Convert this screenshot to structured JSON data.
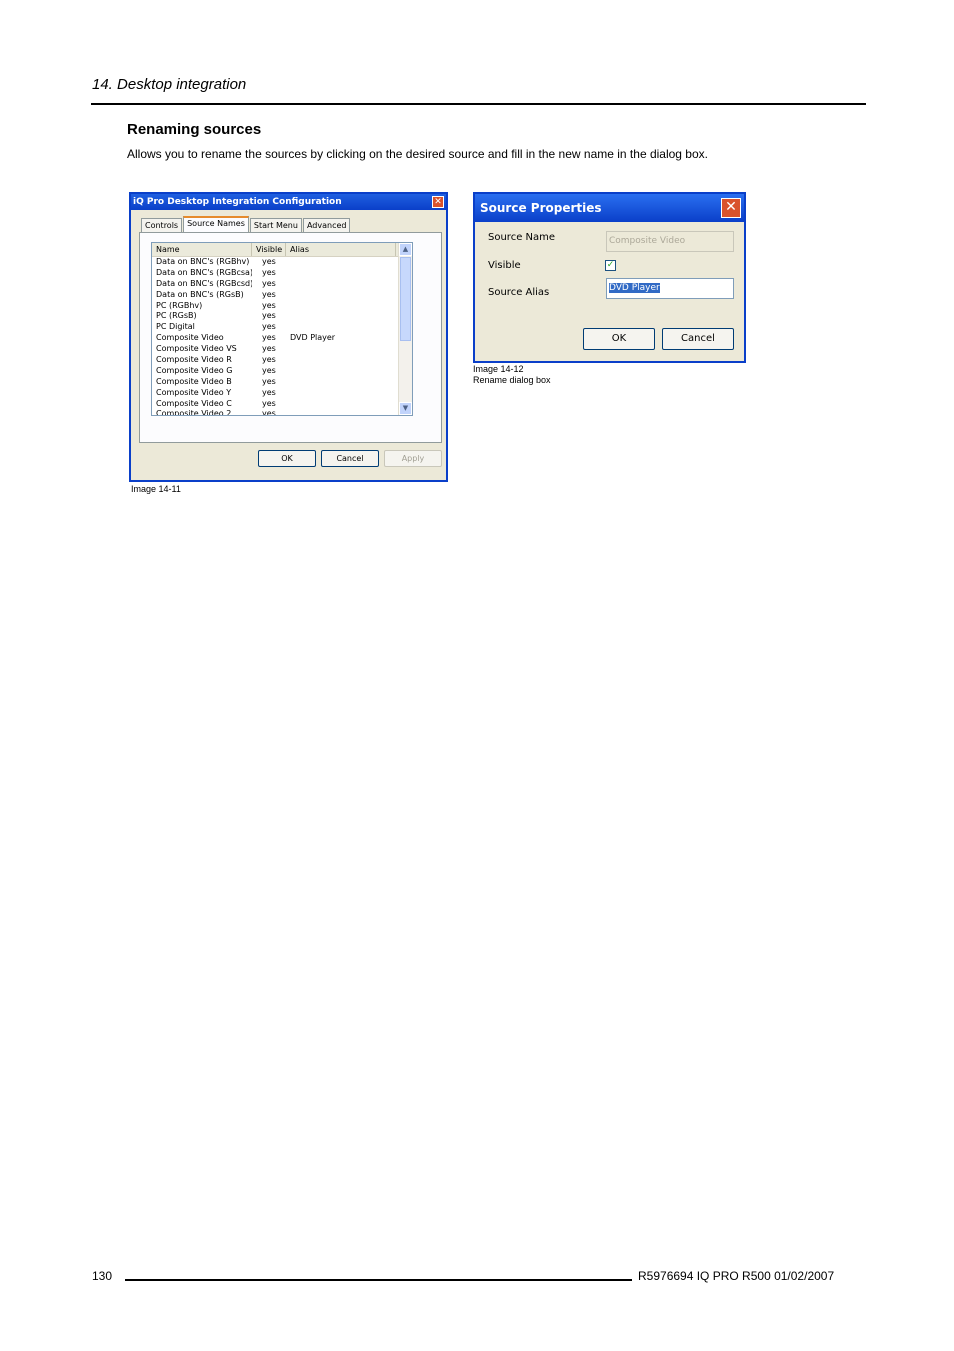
{
  "chapter": "14.  Desktop integration",
  "section_title": "Renaming sources",
  "intro": "Allows you to rename the sources by clicking on the desired source and fill in the new name in the dialog box.",
  "dialog1": {
    "title": "iQ Pro Desktop Integration Configuration",
    "tabs": [
      "Controls",
      "Source Names",
      "Start Menu",
      "Advanced"
    ],
    "columns": [
      "Name",
      "Visible",
      "Alias"
    ],
    "rows": [
      {
        "name": "Data on BNC's (RGBhv)",
        "visible": "yes",
        "alias": ""
      },
      {
        "name": "Data on BNC's (RGBcsa)",
        "visible": "yes",
        "alias": ""
      },
      {
        "name": "Data on BNC's (RGBcsd)",
        "visible": "yes",
        "alias": ""
      },
      {
        "name": "Data on BNC's (RGsB)",
        "visible": "yes",
        "alias": ""
      },
      {
        "name": "PC (RGBhv)",
        "visible": "yes",
        "alias": ""
      },
      {
        "name": "PC (RGsB)",
        "visible": "yes",
        "alias": ""
      },
      {
        "name": "PC Digital",
        "visible": "yes",
        "alias": ""
      },
      {
        "name": "Composite Video",
        "visible": "yes",
        "alias": "DVD Player"
      },
      {
        "name": "Composite Video VS",
        "visible": "yes",
        "alias": ""
      },
      {
        "name": "Composite Video R",
        "visible": "yes",
        "alias": ""
      },
      {
        "name": "Composite Video G",
        "visible": "yes",
        "alias": ""
      },
      {
        "name": "Composite Video B",
        "visible": "yes",
        "alias": ""
      },
      {
        "name": "Composite Video Y",
        "visible": "yes",
        "alias": ""
      },
      {
        "name": "Composite Video C",
        "visible": "yes",
        "alias": ""
      },
      {
        "name": "Composite Video 2",
        "visible": "yes",
        "alias": ""
      }
    ],
    "ok": "OK",
    "cancel": "Cancel",
    "apply": "Apply",
    "caption": "Image 14-11"
  },
  "dialog2": {
    "title": "Source Properties",
    "source_name_label": "Source Name",
    "source_name_value": "Composite Video",
    "visible_label": "Visible",
    "visible_check": "✓",
    "source_alias_label": "Source Alias",
    "source_alias_value": "DVD Player",
    "ok": "OK",
    "cancel": "Cancel",
    "caption_line1": "Image 14-12",
    "caption_line2": "Rename dialog box"
  },
  "footer": {
    "page_number": "130",
    "info": "R5976694   IQ PRO R500   01/02/2007"
  }
}
